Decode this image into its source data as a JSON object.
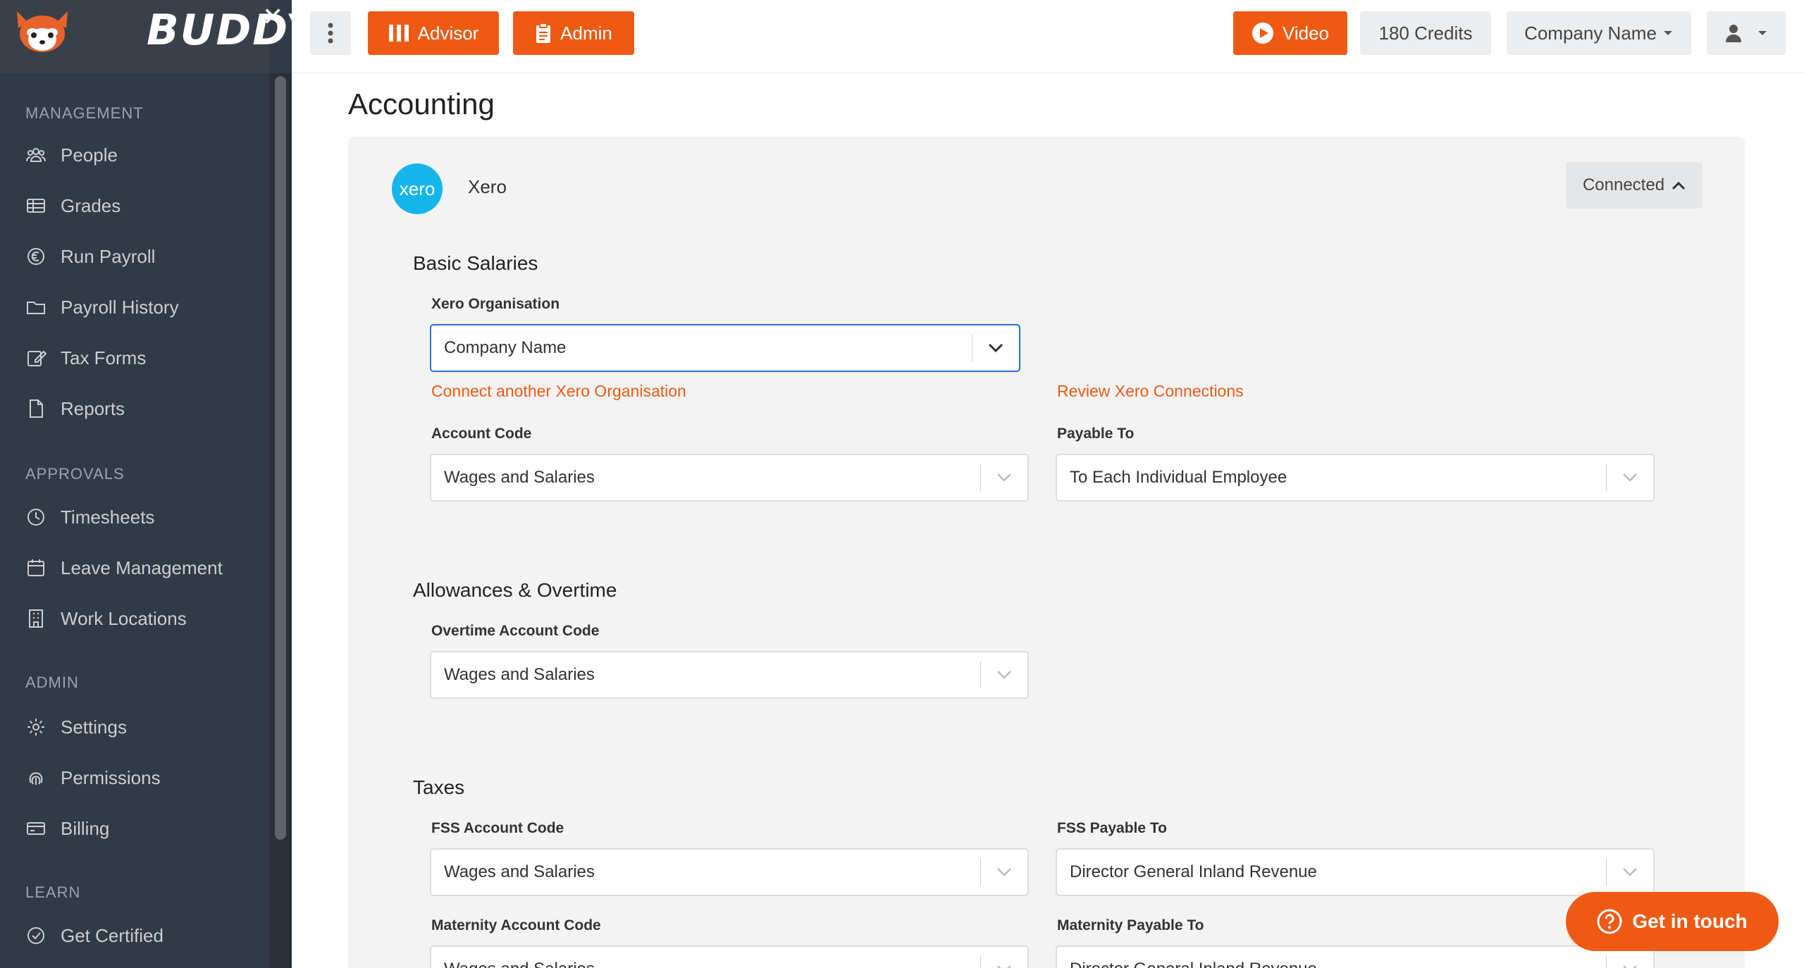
{
  "sidebar": {
    "brand": "BUDDY",
    "sections": [
      {
        "title": "MANAGEMENT",
        "items": [
          {
            "label": "People",
            "icon": "users-icon"
          },
          {
            "label": "Grades",
            "icon": "table-icon"
          },
          {
            "label": "Run Payroll",
            "icon": "euro-icon"
          },
          {
            "label": "Payroll History",
            "icon": "folder-icon"
          },
          {
            "label": "Tax Forms",
            "icon": "edit-icon"
          },
          {
            "label": "Reports",
            "icon": "file-icon"
          }
        ]
      },
      {
        "title": "APPROVALS",
        "items": [
          {
            "label": "Timesheets",
            "icon": "clock-icon"
          },
          {
            "label": "Leave Management",
            "icon": "calendar-icon"
          },
          {
            "label": "Work Locations",
            "icon": "building-icon"
          }
        ]
      },
      {
        "title": "ADMIN",
        "items": [
          {
            "label": "Settings",
            "icon": "gear-icon"
          },
          {
            "label": "Permissions",
            "icon": "fingerprint-icon"
          },
          {
            "label": "Billing",
            "icon": "credit-card-icon"
          }
        ]
      },
      {
        "title": "LEARN",
        "items": [
          {
            "label": "Get Certified",
            "icon": "check-circle-icon"
          }
        ]
      }
    ]
  },
  "topbar": {
    "advisor_label": "Advisor",
    "admin_label": "Admin",
    "video_label": "Video",
    "credits_label": "180 Credits",
    "company_label": "Company Name"
  },
  "main": {
    "title": "Accounting",
    "integration": {
      "logo_text": "xero",
      "name": "Xero",
      "status_label": "Connected"
    },
    "basic_salaries": {
      "title": "Basic Salaries",
      "org_label": "Xero Organisation",
      "org_value": "Company Name",
      "connect_link": "Connect another Xero Organisation",
      "review_link": "Review Xero Connections",
      "account_code_label": "Account Code",
      "account_code_value": "Wages and Salaries",
      "payable_to_label": "Payable To",
      "payable_to_value": "To Each Individual Employee"
    },
    "allowances": {
      "title": "Allowances & Overtime",
      "overtime_label": "Overtime Account Code",
      "overtime_value": "Wages and Salaries"
    },
    "taxes": {
      "title": "Taxes",
      "fss_account_label": "FSS Account Code",
      "fss_account_value": "Wages and Salaries",
      "fss_payable_label": "FSS Payable To",
      "fss_payable_value": "Director General Inland Revenue",
      "maternity_account_label": "Maternity Account Code",
      "maternity_account_value": "Wages and Salaries",
      "maternity_payable_label": "Maternity Payable To",
      "maternity_payable_value": "Director General Inland Revenue"
    }
  },
  "help": {
    "label": "Get in touch"
  },
  "colors": {
    "accent": "#ee5a14",
    "sidebar": "#323a45",
    "xero": "#13b5ea",
    "focus": "#2d6bd8"
  }
}
